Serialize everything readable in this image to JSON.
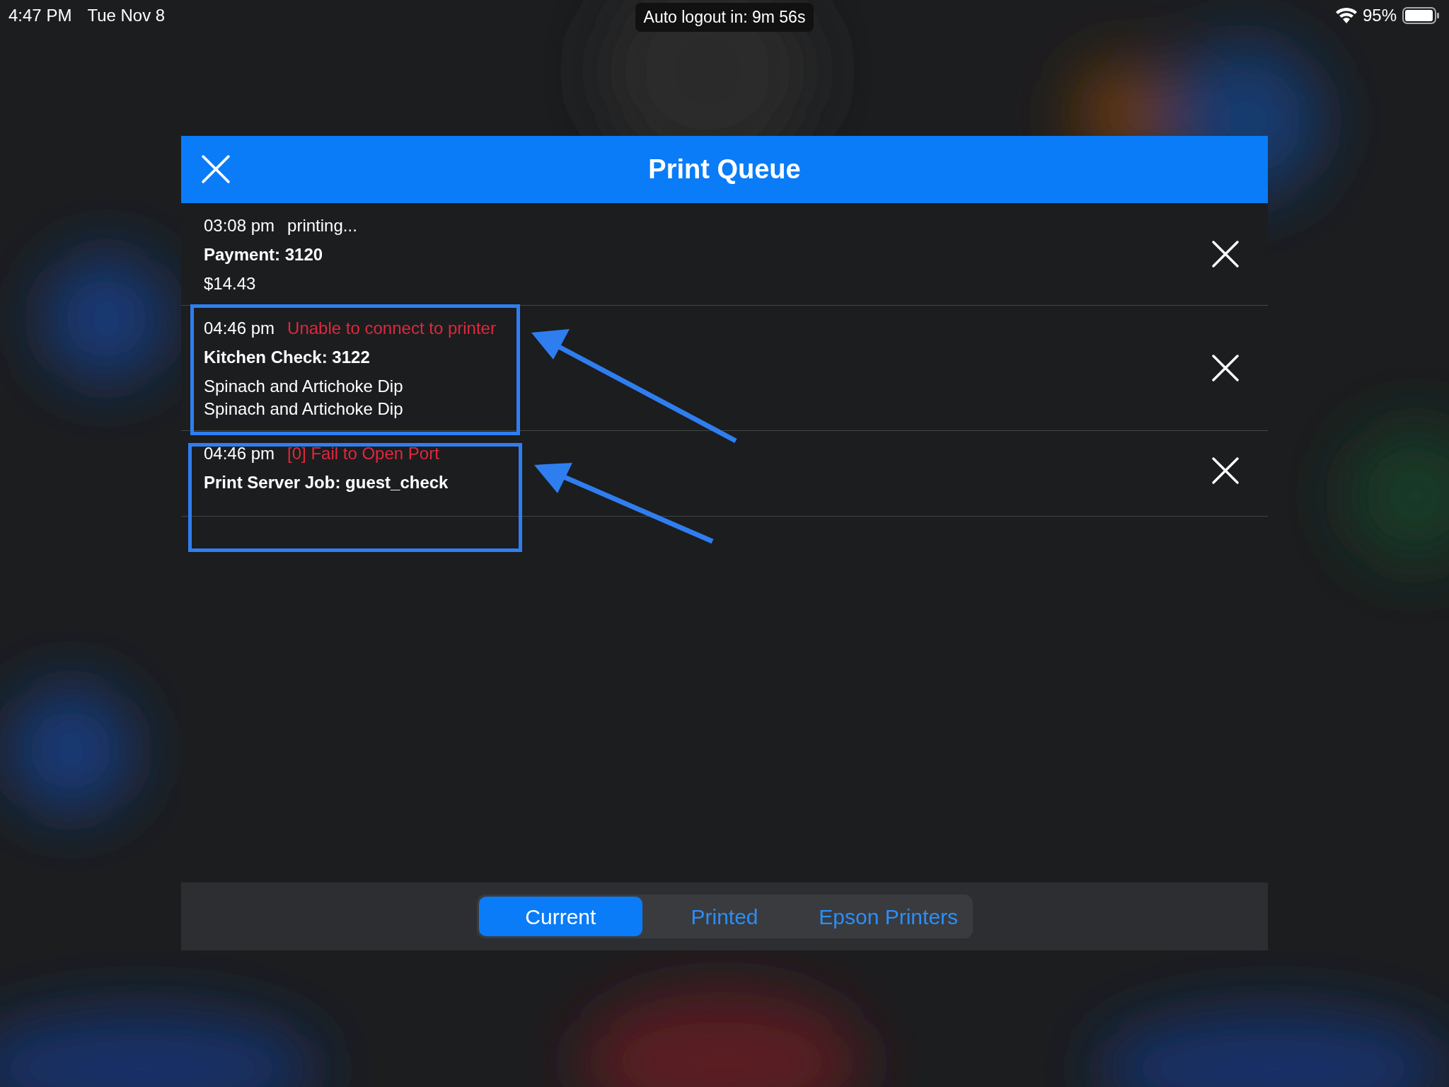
{
  "status_bar": {
    "time": "4:47 PM",
    "date": "Tue Nov 8",
    "banner": "Auto logout in: 9m 56s",
    "battery": "95%"
  },
  "dialog": {
    "title": "Print Queue",
    "jobs": [
      {
        "time": "03:08 pm",
        "status": "printing...",
        "error": false,
        "title": "Payment: 3120",
        "lines": [
          "$14.43"
        ]
      },
      {
        "time": "04:46 pm",
        "status": "Unable to connect to printer",
        "error": true,
        "title": "Kitchen Check: 3122",
        "lines": [
          "Spinach and Artichoke Dip",
          "Spinach and Artichoke Dip"
        ]
      },
      {
        "time": "04:46 pm",
        "status": "[0] Fail to Open Port",
        "error": true,
        "title": "Print Server Job: guest_check"
      }
    ],
    "tabs": [
      {
        "label": "Current",
        "selected": true
      },
      {
        "label": "Printed",
        "selected": false
      },
      {
        "label": "Epson Printers",
        "selected": false
      }
    ]
  }
}
